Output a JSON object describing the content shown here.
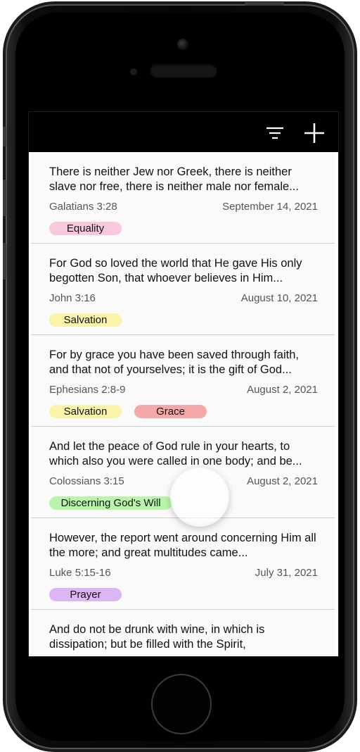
{
  "toolbar": {
    "filter_icon": "filter-icon",
    "add_icon": "add-icon"
  },
  "verses": [
    {
      "text": "There is neither Jew nor Greek, there is neither slave nor free, there is neither male nor female...",
      "reference": "Galatians 3:28",
      "date": "September 14, 2021",
      "tags": [
        {
          "label": "Equality",
          "color": "#f8c8dc"
        }
      ]
    },
    {
      "text": "For God so loved the world that He gave His only begotten Son, that whoever believes in Him...",
      "reference": "John 3:16",
      "date": "August 10, 2021",
      "tags": [
        {
          "label": "Salvation",
          "color": "#fbf3a7"
        }
      ]
    },
    {
      "text": "For by grace you have been saved through faith, and that not of yourselves; it is the gift of God...",
      "reference": "Ephesians 2:8-9",
      "date": "August 2, 2021",
      "tags": [
        {
          "label": "Salvation",
          "color": "#fbf3a7"
        },
        {
          "label": "Grace",
          "color": "#f4a9a8"
        }
      ]
    },
    {
      "text": "And let the peace of God rule in your hearts, to which also you were called in one body; and be...",
      "reference": "Colossians 3:15",
      "date": "August 2, 2021",
      "tags": [
        {
          "label": "Discerning God's Will",
          "color": "#b9f5a9"
        }
      ]
    },
    {
      "text": "However, the report went around concerning Him all the more; and great multitudes came...",
      "reference": "Luke 5:15-16",
      "date": "July 31, 2021",
      "tags": [
        {
          "label": "Prayer",
          "color": "#dcb5f5"
        }
      ]
    },
    {
      "text": "And do not be drunk with wine, in which is dissipation; but be filled with the Spirit,"
    }
  ]
}
